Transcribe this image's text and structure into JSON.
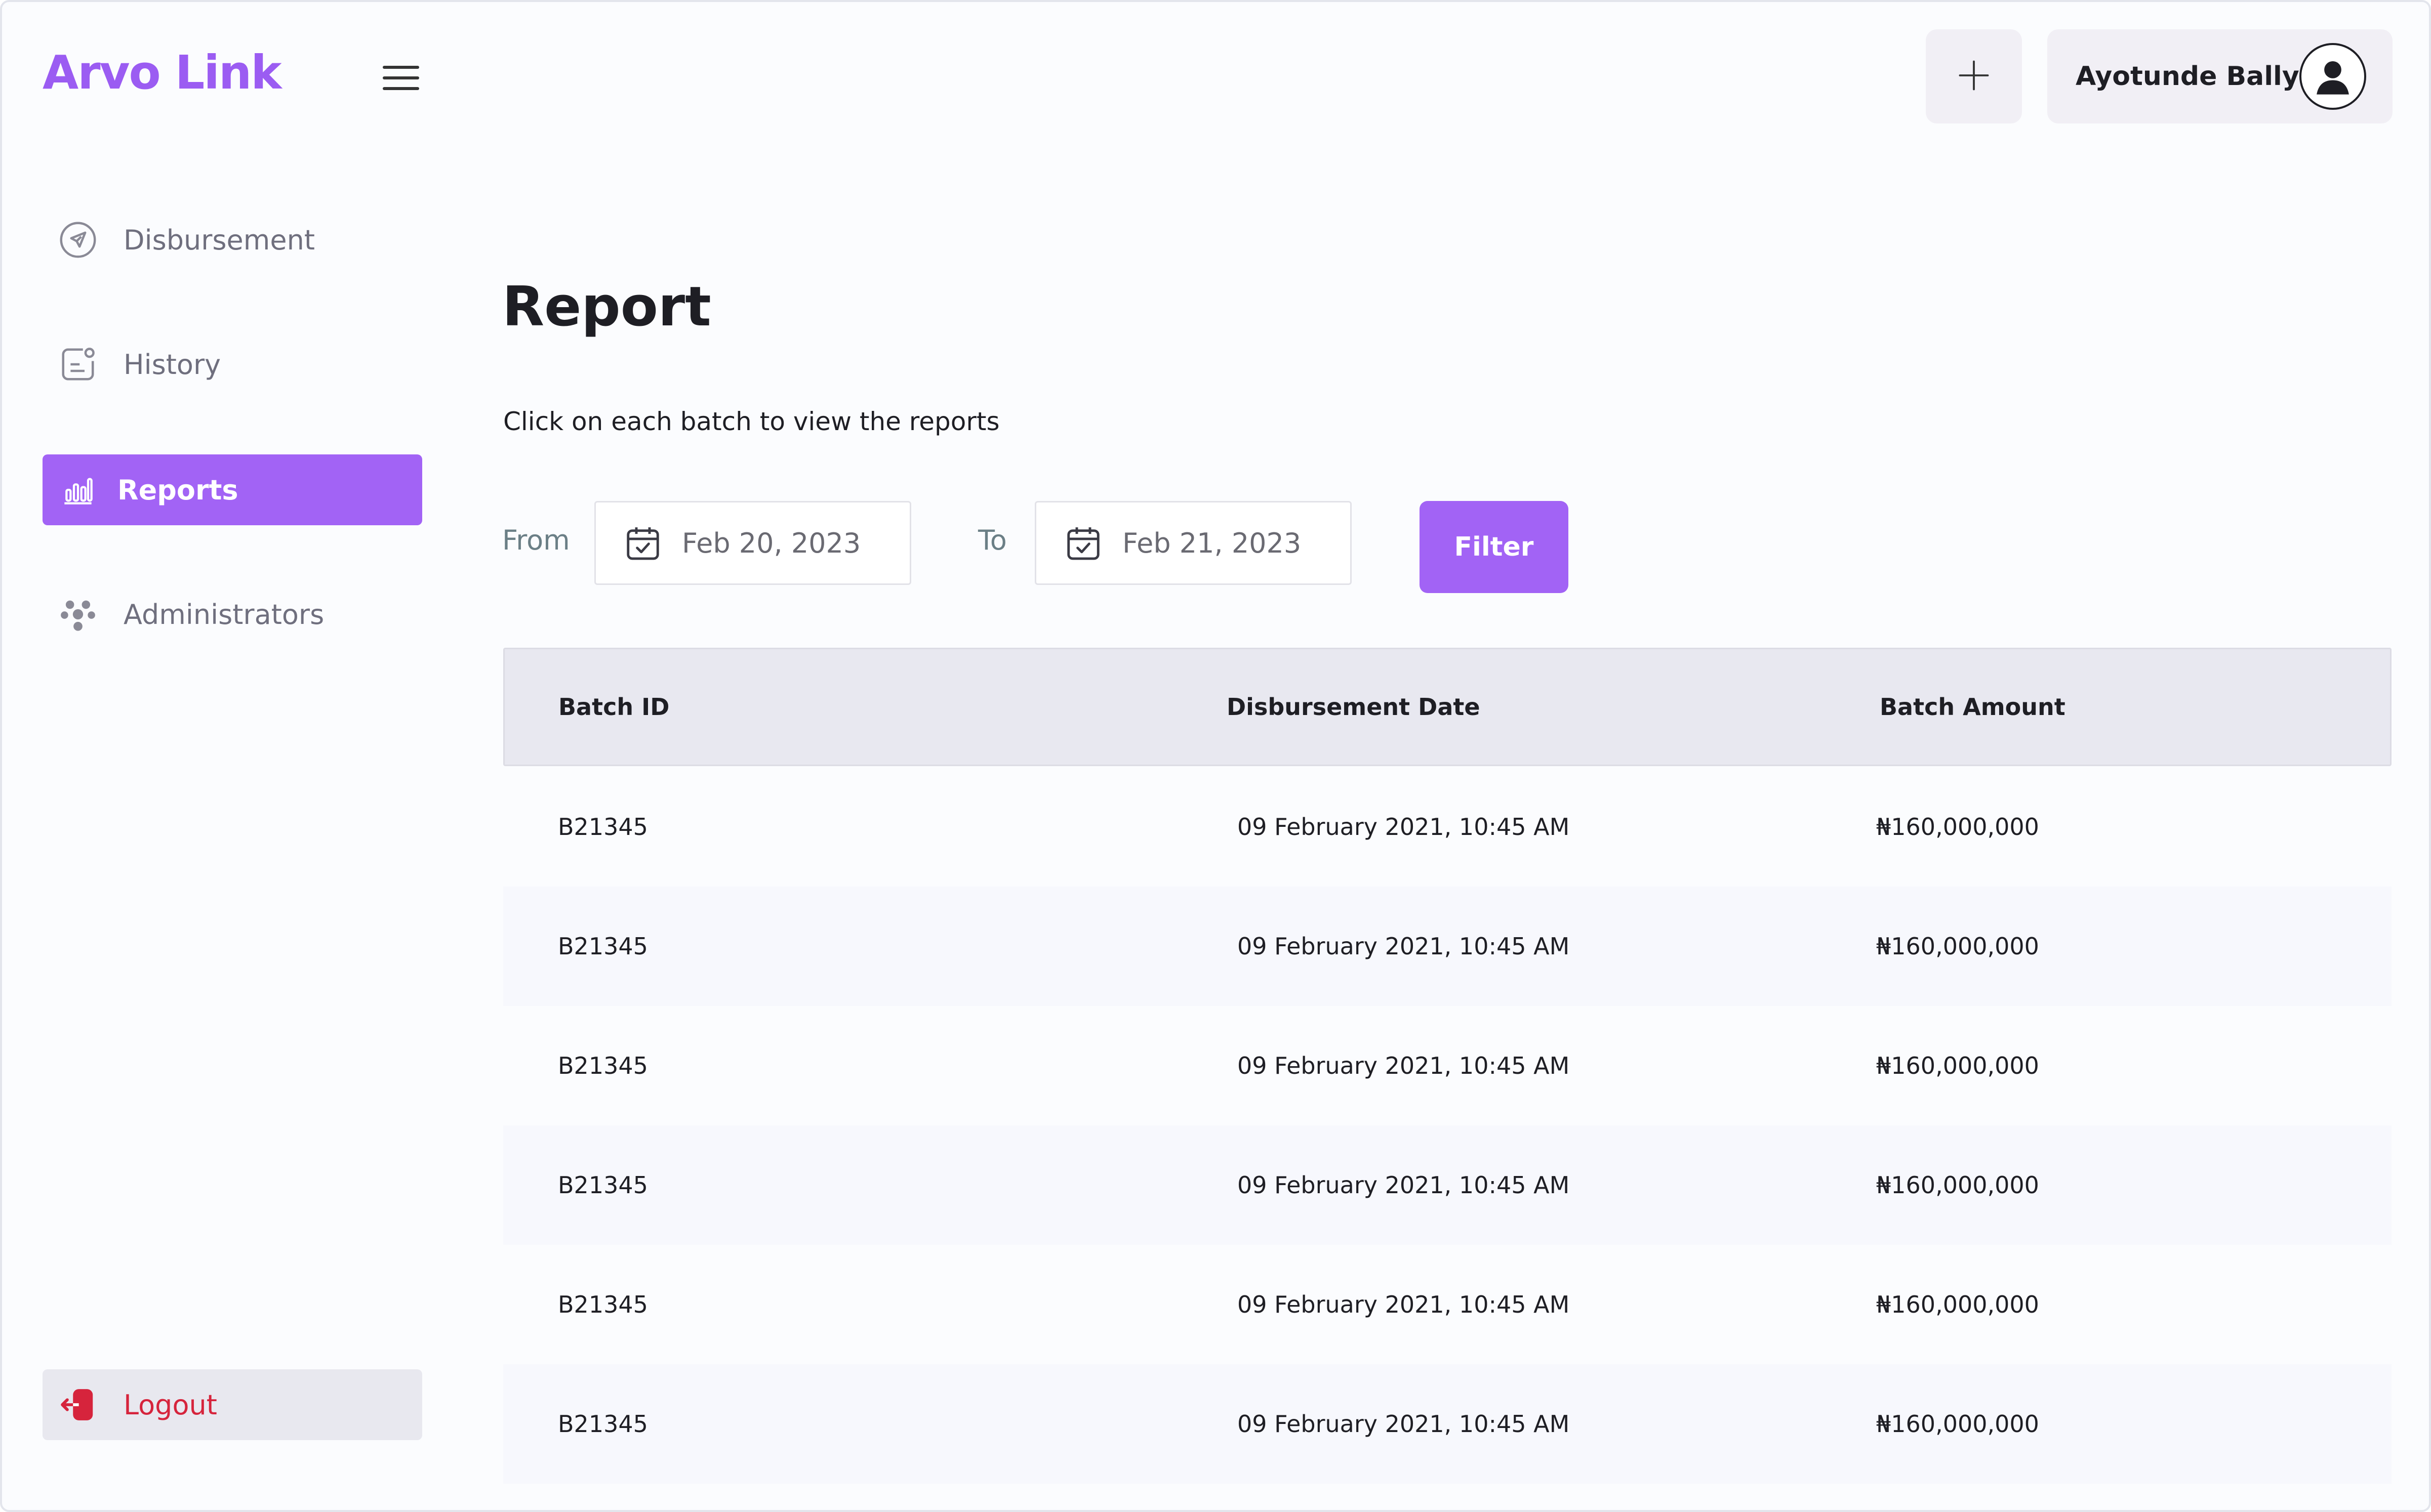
{
  "brand": {
    "name": "Arvo Link",
    "color": "#9b5cf2"
  },
  "sidebar": {
    "items": [
      {
        "label": "Disbursement",
        "icon": "send-icon"
      },
      {
        "label": "History",
        "icon": "history-icon"
      },
      {
        "label": "Reports",
        "icon": "bar-chart-icon",
        "active": true
      },
      {
        "label": "Administrators",
        "icon": "people-icon"
      }
    ],
    "logout": {
      "label": "Logout",
      "icon": "logout-icon"
    }
  },
  "header": {
    "add_icon": "plus-icon",
    "user_name": "Ayotunde Bally",
    "avatar_icon": "user-icon"
  },
  "main": {
    "title": "Report",
    "subtitle": "Click on each batch to view the reports",
    "filter": {
      "from_label": "From",
      "from_value": "Feb 20, 2023",
      "to_label": "To",
      "to_value": "Feb 21, 2023",
      "button_label": "Filter",
      "calendar_icon": "calendar-icon"
    },
    "table": {
      "columns": [
        "Batch ID",
        "Disbursement Date",
        "Batch Amount"
      ],
      "rows": [
        [
          "B21345",
          "09 February 2021, 10:45 AM",
          "₦160,000,000"
        ],
        [
          "B21345",
          "09 February 2021, 10:45 AM",
          "₦160,000,000"
        ],
        [
          "B21345",
          "09 February 2021, 10:45 AM",
          "₦160,000,000"
        ],
        [
          "B21345",
          "09 February 2021, 10:45 AM",
          "₦160,000,000"
        ],
        [
          "B21345",
          "09 February 2021, 10:45 AM",
          "₦160,000,000"
        ],
        [
          "B21345",
          "09 February 2021, 10:45 AM",
          "₦160,000,000"
        ]
      ]
    }
  },
  "colors": {
    "accent": "#a263f5",
    "danger": "#d6243c",
    "muted_text": "#6f6f7e",
    "table_header_bg": "#e8e8f0"
  }
}
